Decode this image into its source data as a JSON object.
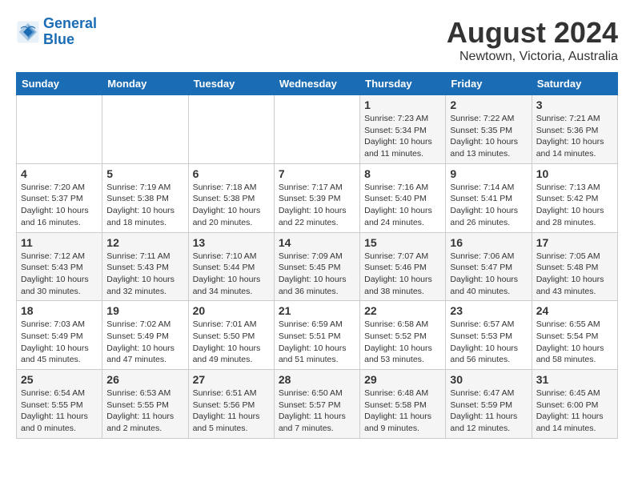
{
  "logo": {
    "line1": "General",
    "line2": "Blue"
  },
  "title": "August 2024",
  "location": "Newtown, Victoria, Australia",
  "days_of_week": [
    "Sunday",
    "Monday",
    "Tuesday",
    "Wednesday",
    "Thursday",
    "Friday",
    "Saturday"
  ],
  "weeks": [
    [
      {
        "day": "",
        "info": ""
      },
      {
        "day": "",
        "info": ""
      },
      {
        "day": "",
        "info": ""
      },
      {
        "day": "",
        "info": ""
      },
      {
        "day": "1",
        "info": "Sunrise: 7:23 AM\nSunset: 5:34 PM\nDaylight: 10 hours\nand 11 minutes."
      },
      {
        "day": "2",
        "info": "Sunrise: 7:22 AM\nSunset: 5:35 PM\nDaylight: 10 hours\nand 13 minutes."
      },
      {
        "day": "3",
        "info": "Sunrise: 7:21 AM\nSunset: 5:36 PM\nDaylight: 10 hours\nand 14 minutes."
      }
    ],
    [
      {
        "day": "4",
        "info": "Sunrise: 7:20 AM\nSunset: 5:37 PM\nDaylight: 10 hours\nand 16 minutes."
      },
      {
        "day": "5",
        "info": "Sunrise: 7:19 AM\nSunset: 5:38 PM\nDaylight: 10 hours\nand 18 minutes."
      },
      {
        "day": "6",
        "info": "Sunrise: 7:18 AM\nSunset: 5:38 PM\nDaylight: 10 hours\nand 20 minutes."
      },
      {
        "day": "7",
        "info": "Sunrise: 7:17 AM\nSunset: 5:39 PM\nDaylight: 10 hours\nand 22 minutes."
      },
      {
        "day": "8",
        "info": "Sunrise: 7:16 AM\nSunset: 5:40 PM\nDaylight: 10 hours\nand 24 minutes."
      },
      {
        "day": "9",
        "info": "Sunrise: 7:14 AM\nSunset: 5:41 PM\nDaylight: 10 hours\nand 26 minutes."
      },
      {
        "day": "10",
        "info": "Sunrise: 7:13 AM\nSunset: 5:42 PM\nDaylight: 10 hours\nand 28 minutes."
      }
    ],
    [
      {
        "day": "11",
        "info": "Sunrise: 7:12 AM\nSunset: 5:43 PM\nDaylight: 10 hours\nand 30 minutes."
      },
      {
        "day": "12",
        "info": "Sunrise: 7:11 AM\nSunset: 5:43 PM\nDaylight: 10 hours\nand 32 minutes."
      },
      {
        "day": "13",
        "info": "Sunrise: 7:10 AM\nSunset: 5:44 PM\nDaylight: 10 hours\nand 34 minutes."
      },
      {
        "day": "14",
        "info": "Sunrise: 7:09 AM\nSunset: 5:45 PM\nDaylight: 10 hours\nand 36 minutes."
      },
      {
        "day": "15",
        "info": "Sunrise: 7:07 AM\nSunset: 5:46 PM\nDaylight: 10 hours\nand 38 minutes."
      },
      {
        "day": "16",
        "info": "Sunrise: 7:06 AM\nSunset: 5:47 PM\nDaylight: 10 hours\nand 40 minutes."
      },
      {
        "day": "17",
        "info": "Sunrise: 7:05 AM\nSunset: 5:48 PM\nDaylight: 10 hours\nand 43 minutes."
      }
    ],
    [
      {
        "day": "18",
        "info": "Sunrise: 7:03 AM\nSunset: 5:49 PM\nDaylight: 10 hours\nand 45 minutes."
      },
      {
        "day": "19",
        "info": "Sunrise: 7:02 AM\nSunset: 5:49 PM\nDaylight: 10 hours\nand 47 minutes."
      },
      {
        "day": "20",
        "info": "Sunrise: 7:01 AM\nSunset: 5:50 PM\nDaylight: 10 hours\nand 49 minutes."
      },
      {
        "day": "21",
        "info": "Sunrise: 6:59 AM\nSunset: 5:51 PM\nDaylight: 10 hours\nand 51 minutes."
      },
      {
        "day": "22",
        "info": "Sunrise: 6:58 AM\nSunset: 5:52 PM\nDaylight: 10 hours\nand 53 minutes."
      },
      {
        "day": "23",
        "info": "Sunrise: 6:57 AM\nSunset: 5:53 PM\nDaylight: 10 hours\nand 56 minutes."
      },
      {
        "day": "24",
        "info": "Sunrise: 6:55 AM\nSunset: 5:54 PM\nDaylight: 10 hours\nand 58 minutes."
      }
    ],
    [
      {
        "day": "25",
        "info": "Sunrise: 6:54 AM\nSunset: 5:55 PM\nDaylight: 11 hours\nand 0 minutes."
      },
      {
        "day": "26",
        "info": "Sunrise: 6:53 AM\nSunset: 5:55 PM\nDaylight: 11 hours\nand 2 minutes."
      },
      {
        "day": "27",
        "info": "Sunrise: 6:51 AM\nSunset: 5:56 PM\nDaylight: 11 hours\nand 5 minutes."
      },
      {
        "day": "28",
        "info": "Sunrise: 6:50 AM\nSunset: 5:57 PM\nDaylight: 11 hours\nand 7 minutes."
      },
      {
        "day": "29",
        "info": "Sunrise: 6:48 AM\nSunset: 5:58 PM\nDaylight: 11 hours\nand 9 minutes."
      },
      {
        "day": "30",
        "info": "Sunrise: 6:47 AM\nSunset: 5:59 PM\nDaylight: 11 hours\nand 12 minutes."
      },
      {
        "day": "31",
        "info": "Sunrise: 6:45 AM\nSunset: 6:00 PM\nDaylight: 11 hours\nand 14 minutes."
      }
    ]
  ]
}
